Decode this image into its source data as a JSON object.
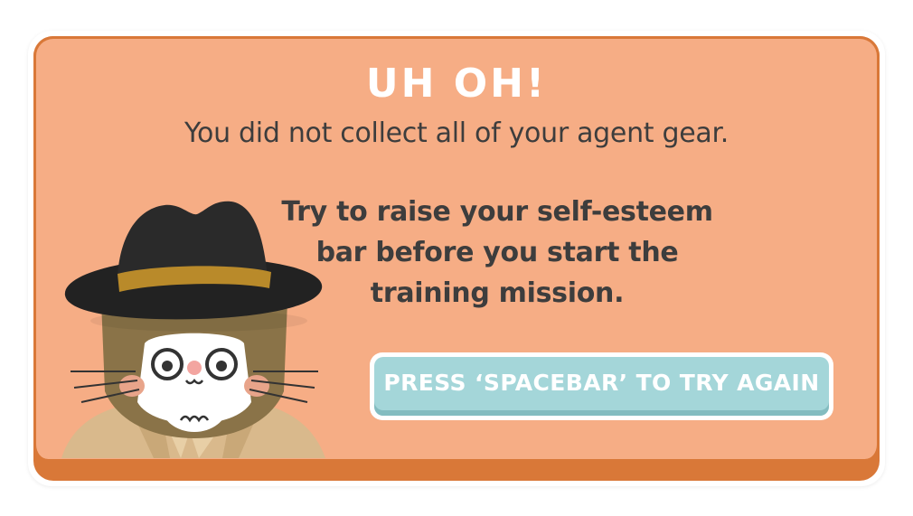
{
  "dialog": {
    "title": "UH OH!",
    "subtitle": "You did not collect all of your agent gear.",
    "instruction_lines": [
      "Try to raise your self-esteem",
      "bar before you start the",
      "training mission."
    ],
    "button_label": "PRESS ‘SPACEBAR’ TO TRY AGAIN"
  },
  "character": {
    "icon": "agent-cat-icon"
  },
  "colors": {
    "panel": "#f6ad85",
    "panel_border": "#d97838",
    "button": "#a4d6d9",
    "text": "#3d3d3d",
    "title": "#ffffff"
  }
}
